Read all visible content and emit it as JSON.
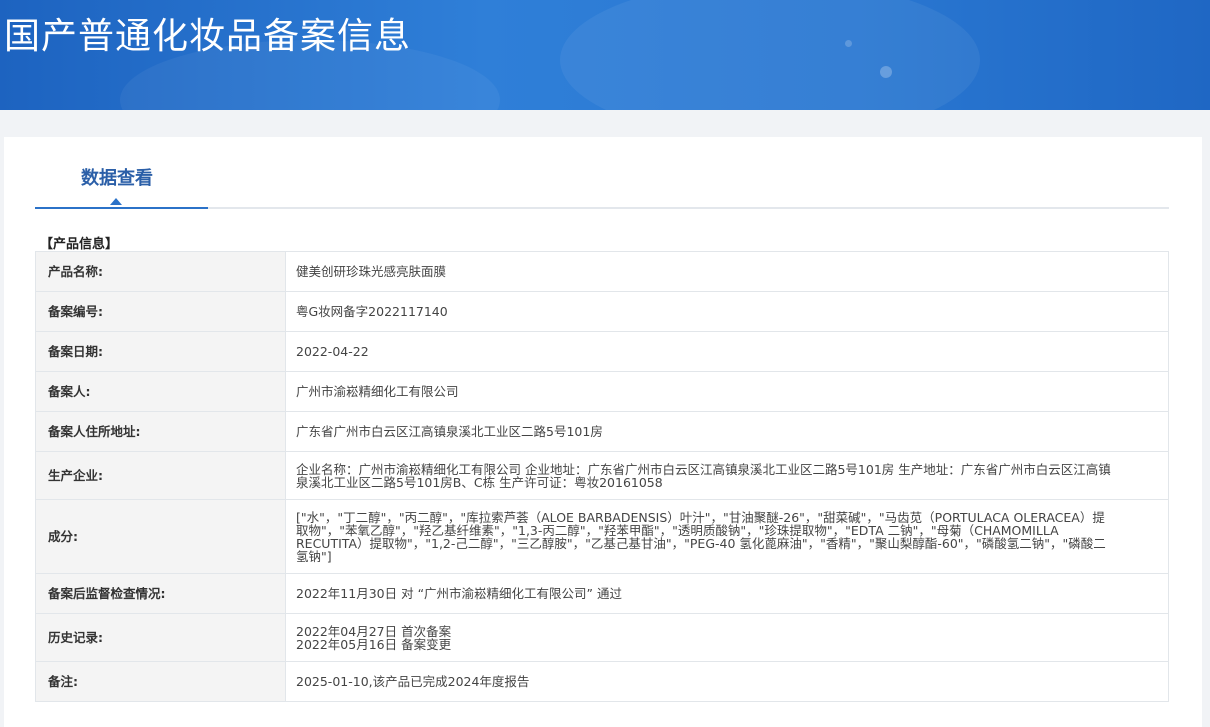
{
  "header": {
    "title": "国产普通化妆品备案信息"
  },
  "tabs": [
    {
      "label": "数据查看"
    }
  ],
  "section": {
    "title": "【产品信息】"
  },
  "rows": [
    {
      "label": "产品名称:",
      "value": "健美创研珍珠光感亮肤面膜"
    },
    {
      "label": "备案编号:",
      "value": "粤G妆网备字2022117140"
    },
    {
      "label": "备案日期:",
      "value": "2022-04-22"
    },
    {
      "label": "备案人:",
      "value": "广州市渝崧精细化工有限公司"
    },
    {
      "label": "备案人住所地址:",
      "value": "广东省广州市白云区江高镇泉溪北工业区二路5号101房"
    },
    {
      "label": "生产企业:",
      "value": "企业名称：广州市渝崧精细化工有限公司 企业地址：广东省广州市白云区江高镇泉溪北工业区二路5号101房 生产地址：广东省广州市白云区江高镇泉溪北工业区二路5号101房B、C栋 生产许可证：粤妆20161058"
    },
    {
      "label": "成分:",
      "value": "[\"水\"，\"丁二醇\"，\"丙二醇\"，\"库拉索芦荟（ALOE BARBADENSIS）叶汁\"，\"甘油聚醚-26\"，\"甜菜碱\"，\"马齿苋（PORTULACA OLERACEA）提取物\"，\"苯氧乙醇\"，\"羟乙基纤维素\"，\"1,3-丙二醇\"，\"羟苯甲酯\"，\"透明质酸钠\"，\"珍珠提取物\"，\"EDTA 二钠\"，\"母菊（CHAMOMILLA RECUTITA）提取物\"，\"1,2-己二醇\"，\"三乙醇胺\"，\"乙基己基甘油\"，\"PEG-40 氢化蓖麻油\"，\"香精\"，\"聚山梨醇酯-60\"，\"磷酸氢二钠\"，\"磷酸二氢钠\"]"
    },
    {
      "label": "备案后监督检查情况:",
      "value": "2022年11月30日 对 “广州市渝崧精细化工有限公司” 通过"
    },
    {
      "label": "历史记录:",
      "lines": [
        "2022年04月27日 首次备案",
        "2022年05月16日 备案变更"
      ]
    },
    {
      "label": "备注:",
      "value": "2025-01-10,该产品已完成2024年度报告"
    }
  ]
}
